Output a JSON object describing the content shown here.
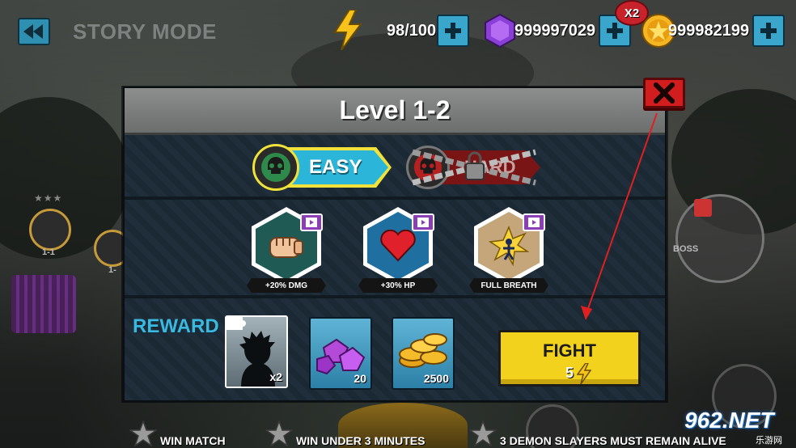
{
  "screen": {
    "title": "STORY MODE"
  },
  "resources": {
    "energy": {
      "icon": "lightning-icon",
      "value": "98/100"
    },
    "gems": {
      "icon": "gem-icon",
      "value": "999997029",
      "badge": "X2"
    },
    "coins": {
      "icon": "coin-icon",
      "value": "999982199"
    }
  },
  "modal": {
    "title": "Level 1-2",
    "difficulty": {
      "selected": {
        "label": "EASY",
        "color": "#2bb6d9"
      },
      "locked": {
        "label": "HARD",
        "locked": true
      }
    },
    "boosts": [
      {
        "icon": "fist-icon",
        "label": "+20% DMG",
        "bg": "#1f5a55"
      },
      {
        "icon": "heart-icon",
        "label": "+30% HP",
        "bg": "#1f6fa0"
      },
      {
        "icon": "burst-figure-icon",
        "label": "FULL BREATH",
        "bg": "#c5a57a"
      }
    ],
    "reward": {
      "label": "REWARD",
      "items": [
        {
          "icon": "character-silhouette-icon",
          "qty": "x2"
        },
        {
          "icon": "gem-pile-icon",
          "qty": "20"
        },
        {
          "icon": "coin-pile-icon",
          "qty": "2500"
        }
      ]
    },
    "fight": {
      "label": "FIGHT",
      "cost": "5"
    }
  },
  "objectives": [
    "WIN MATCH",
    "WIN UNDER 3 MINUTES",
    "3 DEMON SLAYERS MUST REMAIN ALIVE"
  ],
  "map": {
    "nodes": [
      "1-1",
      "1-"
    ],
    "boss_label": "BOSS"
  },
  "colors": {
    "accent": "#3aa6cc",
    "close": "#d11d1d",
    "fight": "#f2d21c",
    "annotation_arrow": "#e02020"
  },
  "watermark": {
    "main": "962.NET",
    "sub": "乐游网"
  }
}
